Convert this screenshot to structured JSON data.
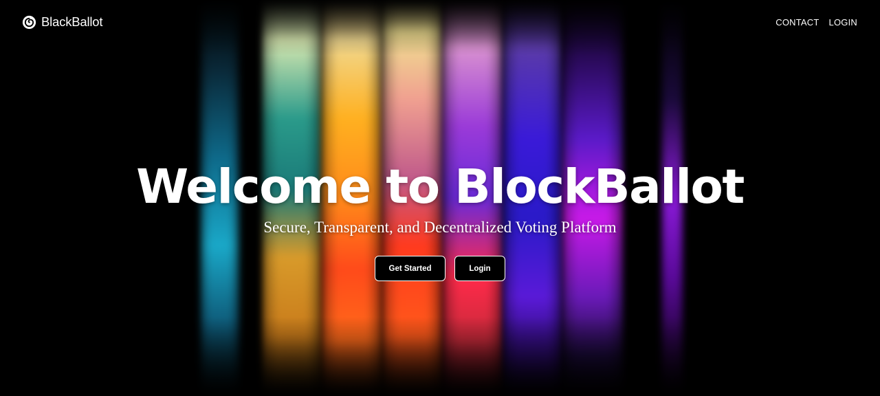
{
  "brand": {
    "name": "BlackBallot",
    "logo_icon": "spiral-logo-icon"
  },
  "nav": {
    "links": [
      {
        "label": "CONTACT"
      },
      {
        "label": "LOGIN"
      }
    ]
  },
  "hero": {
    "title": "Welcome to BlockBallot",
    "subtitle": "Secure, Transparent, and Decentralized Voting Platform",
    "buttons": {
      "get_started": "Get Started",
      "login": "Login"
    }
  },
  "colors": {
    "background": "#000000",
    "text": "#ffffff",
    "band_cyan": "#1aa8c8",
    "band_teal": "#2a9a8a",
    "band_orange": "#ff8a1a",
    "band_red": "#ff3a1e",
    "band_pink": "#e07aa8",
    "band_violet": "#9a3ad8",
    "band_blue": "#3a1ad8",
    "band_magenta": "#c81ae8"
  }
}
